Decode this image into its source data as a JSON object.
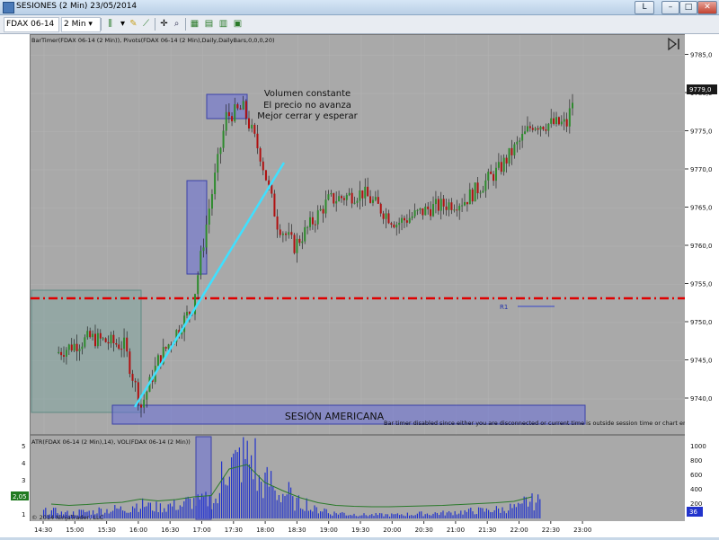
{
  "window": {
    "title": "SESIONES (2 Min)  23/05/2014",
    "minimize": "–",
    "maximize": "□",
    "close": "✕",
    "link_button": "L"
  },
  "toolbar": {
    "instrument": "FDAX 06-14",
    "interval": "2 Min"
  },
  "chart": {
    "indicator_label": "BarTimer(FDAX 06-14 (2 Min)), Pivots(FDAX 06-14 (2 Min),Daily,DailyBars,0,0,0,20)",
    "annotation_lines": [
      "Volumen constante",
      "El precio no avanza",
      "Mejor cerrar y esperar"
    ],
    "session_label": "SESIÓN AMERICANA",
    "bartimer_msg": "Bar timer disabled since either you are disconnected or current time is outside session time or chart end date",
    "pivot_label": "R1",
    "current_price": "9779,0",
    "price_ticks": [
      "9785,0",
      "9780,0",
      "9775,0",
      "9770,0",
      "9765,0",
      "9760,0",
      "9755,0",
      "9750,0",
      "9745,0",
      "9740,0"
    ],
    "time_ticks": [
      "14:30",
      "15:00",
      "15:30",
      "16:00",
      "16:30",
      "17:00",
      "17:30",
      "18:00",
      "18:30",
      "19:00",
      "19:30",
      "20:00",
      "20:30",
      "21:00",
      "21:30",
      "22:00",
      "22:30",
      "23:00"
    ],
    "colors": {
      "up": "#2e8b2e",
      "down": "#b01010",
      "trend_line": "#3fe0ff",
      "pivot": "#e00000",
      "box": "#6a70d8"
    }
  },
  "lower_panel": {
    "label": "ATR(FDAX 06-14 (2 Min),14), VOL(FDAX 06-14 (2 Min))",
    "copyright": "© 2014 NinjaTrader, LLC",
    "atr_ticks": [
      "5",
      "4",
      "3",
      "2",
      "1"
    ],
    "vol_ticks": [
      "1000",
      "800",
      "600",
      "400",
      "200"
    ],
    "atr_value": "2,05",
    "vol_value": "36"
  },
  "chart_data": [
    {
      "type": "candlestick",
      "x_range": [
        "14:10",
        "23:20"
      ],
      "ylim": [
        9736,
        9787
      ],
      "ohlc_approx": [
        {
          "time": "14:30",
          "close": 9746
        },
        {
          "time": "15:00",
          "close": 9748
        },
        {
          "time": "15:30",
          "close": 9747
        },
        {
          "time": "15:45",
          "close": 9739
        },
        {
          "time": "16:00",
          "close": 9745
        },
        {
          "time": "16:30",
          "close": 9752
        },
        {
          "time": "16:45",
          "close": 9765
        },
        {
          "time": "17:00",
          "close": 9777
        },
        {
          "time": "17:15",
          "close": 9778
        },
        {
          "time": "17:30",
          "close": 9772
        },
        {
          "time": "17:45",
          "close": 9763
        },
        {
          "time": "18:00",
          "close": 9760
        },
        {
          "time": "18:30",
          "close": 9766
        },
        {
          "time": "19:00",
          "close": 9767
        },
        {
          "time": "19:30",
          "close": 9763
        },
        {
          "time": "20:00",
          "close": 9765
        },
        {
          "time": "20:30",
          "close": 9766
        },
        {
          "time": "21:00",
          "close": 9770
        },
        {
          "time": "21:30",
          "close": 9776
        },
        {
          "time": "22:00",
          "close": 9776
        },
        {
          "time": "22:05",
          "close": 9779
        }
      ],
      "pivot_R1": 9752
    },
    {
      "type": "bar",
      "series": [
        {
          "name": "VOL",
          "values": [
            120,
            90,
            110,
            140,
            160,
            230,
            190,
            220,
            280,
            310,
            900,
            1000,
            600,
            420,
            260,
            150,
            90,
            70,
            60,
            60,
            70,
            80,
            90,
            110,
            130,
            150,
            180,
            280
          ]
        }
      ],
      "ylim": [
        0,
        1100
      ]
    }
  ]
}
